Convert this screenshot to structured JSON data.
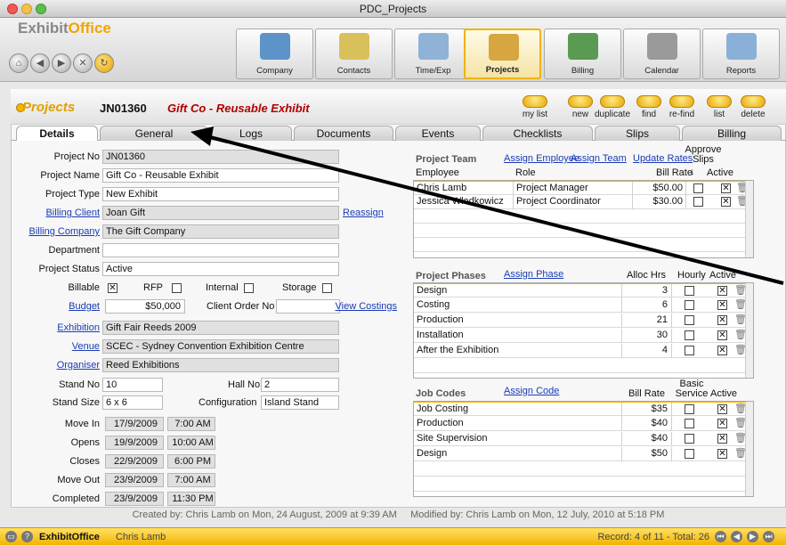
{
  "window": {
    "title": "PDC_Projects"
  },
  "brand": {
    "part1": "Exhibit",
    "part2": "Office"
  },
  "toolbar": [
    {
      "label": "Company",
      "icon": "building-icon",
      "color": "#5c93c8"
    },
    {
      "label": "Contacts",
      "icon": "phone-notes-icon",
      "color": "#d8c15a"
    },
    {
      "label": "Time/Exp",
      "icon": "clock-icon",
      "color": "#8fb2d6"
    },
    {
      "label": "Projects",
      "icon": "projects-icon",
      "color": "#d7a640"
    },
    {
      "label": "Billing",
      "icon": "money-icon",
      "color": "#5a9a52"
    },
    {
      "label": "Calendar",
      "icon": "printer-icon",
      "color": "#9a9a9a"
    },
    {
      "label": "Reports",
      "icon": "reports-icon",
      "color": "#8ab0d8"
    }
  ],
  "header": {
    "section": "Projects",
    "project_no": "JN01360",
    "project_name": "Gift Co - Reusable Exhibit"
  },
  "actions": [
    "my list",
    "new",
    "duplicate",
    "find",
    "re-find",
    "list",
    "delete"
  ],
  "tabs": [
    "Details",
    "General",
    "Logs",
    "Documents",
    "Events",
    "Checklists",
    "Slips",
    "Billing"
  ],
  "form": {
    "project_no_label": "Project No",
    "project_no": "JN01360",
    "project_name_label": "Project Name",
    "project_name": "Gift Co - Reusable Exhibit",
    "project_type_label": "Project Type",
    "project_type": "New Exhibit",
    "billing_client_label": "Billing Client",
    "billing_client": "Joan Gift",
    "reassign": "Reassign",
    "billing_company_label": "Billing Company",
    "billing_company": "The Gift Company",
    "department_label": "Department",
    "department": "",
    "project_status_label": "Project Status",
    "project_status": "Active",
    "billable_label": "Billable",
    "rfp_label": "RFP",
    "internal_label": "Internal",
    "storage_label": "Storage",
    "budget_label": "Budget",
    "budget": "$50,000",
    "client_order_label": "Client Order No",
    "client_order": "",
    "view_costings": "View Costings",
    "exhibition_label": "Exhibition",
    "exhibition": "Gift Fair Reeds 2009",
    "venue_label": "Venue",
    "venue": "SCEC - Sydney Convention Exhibition Centre",
    "organiser_label": "Organiser",
    "organiser": "Reed Exhibitions",
    "stand_no_label": "Stand No",
    "stand_no": "10",
    "hall_no_label": "Hall No",
    "hall_no": "2",
    "stand_size_label": "Stand Size",
    "stand_size": "6 x 6",
    "configuration_label": "Configuration",
    "configuration": "Island Stand",
    "dates": [
      {
        "label": "Move In",
        "date": "17/9/2009",
        "time": "7:00 AM"
      },
      {
        "label": "Opens",
        "date": "19/9/2009",
        "time": "10:00 AM"
      },
      {
        "label": "Closes",
        "date": "22/9/2009",
        "time": "6:00 PM"
      },
      {
        "label": "Move Out",
        "date": "23/9/2009",
        "time": "7:00 AM"
      },
      {
        "label": "Completed",
        "date": "23/9/2009",
        "time": "11:30 PM"
      }
    ]
  },
  "team": {
    "title": "Project Team",
    "assign_employee": "Assign Employee",
    "assign_team": "Assign Team",
    "update_rates": "Update Rates",
    "approve_slips": "Approve Slips",
    "col_employee": "Employee",
    "col_role": "Role",
    "col_rate": "Bill Rate",
    "col_active": "Active",
    "rows": [
      {
        "employee": "Chris Lamb",
        "role": "Project Manager",
        "rate": "$50.00"
      },
      {
        "employee": "Jessica Wlodkowicz",
        "role": "Project Coordinator",
        "rate": "$30.00"
      }
    ]
  },
  "phases": {
    "title": "Project Phases",
    "assign": "Assign Phase",
    "col_alloc": "Alloc Hrs",
    "col_hourly": "Hourly",
    "col_active": "Active",
    "rows": [
      {
        "name": "Design",
        "hrs": "3"
      },
      {
        "name": "Costing",
        "hrs": "6"
      },
      {
        "name": "Production",
        "hrs": "21"
      },
      {
        "name": "Installation",
        "hrs": "30"
      },
      {
        "name": "After the Exhibition",
        "hrs": "4"
      }
    ]
  },
  "jobcodes": {
    "title": "Job Codes",
    "assign": "Assign Code",
    "col_rate": "Bill Rate",
    "col_basic": "Basic Service",
    "col_active": "Active",
    "rows": [
      {
        "name": "Job Costing",
        "rate": "$35"
      },
      {
        "name": "Production",
        "rate": "$40"
      },
      {
        "name": "Site Supervision",
        "rate": "$40"
      },
      {
        "name": "Design",
        "rate": "$50"
      }
    ]
  },
  "footer": {
    "created": "Created by: Chris Lamb on Mon, 24 August, 2009 at 9:39 AM",
    "modified": "Modified by: Chris Lamb on Mon, 12 July, 2010 at 5:18 PM"
  },
  "status": {
    "app": "ExhibitOffice",
    "user": "Chris Lamb",
    "record": "Record: 4 of 11 - Total: 26"
  }
}
